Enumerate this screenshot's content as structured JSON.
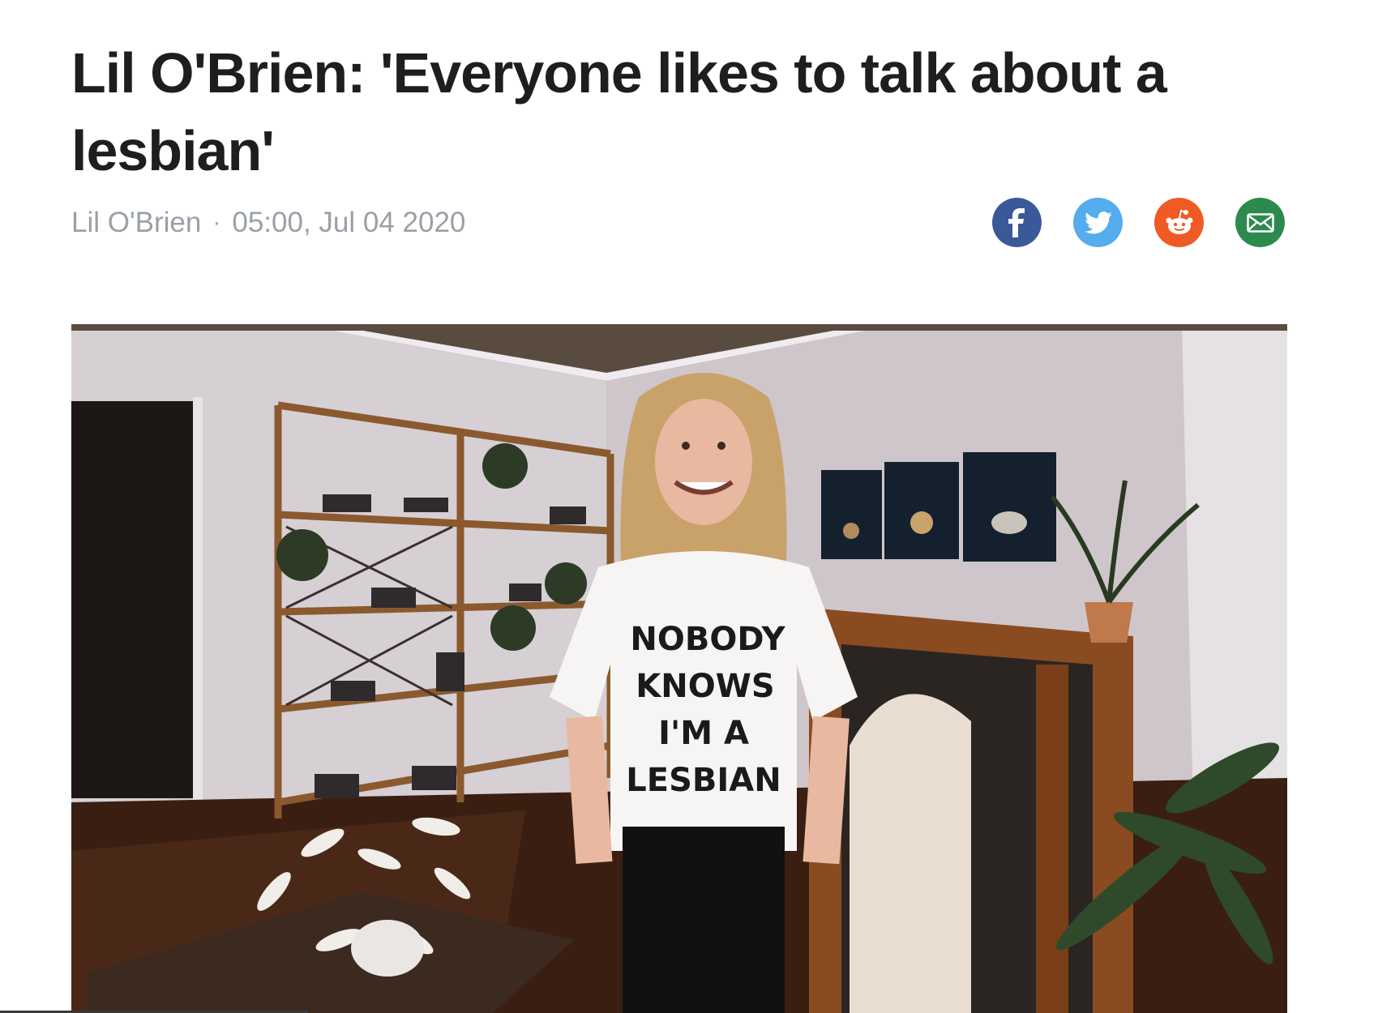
{
  "article": {
    "headline": "Lil O'Brien: 'Everyone likes to talk about a lesbian'",
    "author": "Lil O'Brien",
    "separator": "·",
    "timestamp": "05:00, Jul 04 2020"
  },
  "share": [
    {
      "icon": "facebook-icon",
      "color": "#3b5998"
    },
    {
      "icon": "twitter-icon",
      "color": "#55acee"
    },
    {
      "icon": "reddit-icon",
      "color": "#f05a24"
    },
    {
      "icon": "email-icon",
      "color": "#2d8a4e"
    }
  ],
  "photo": {
    "shirt_lines": [
      "NOBODY",
      "KNOWS",
      "I'M A",
      "LESBIAN"
    ]
  }
}
